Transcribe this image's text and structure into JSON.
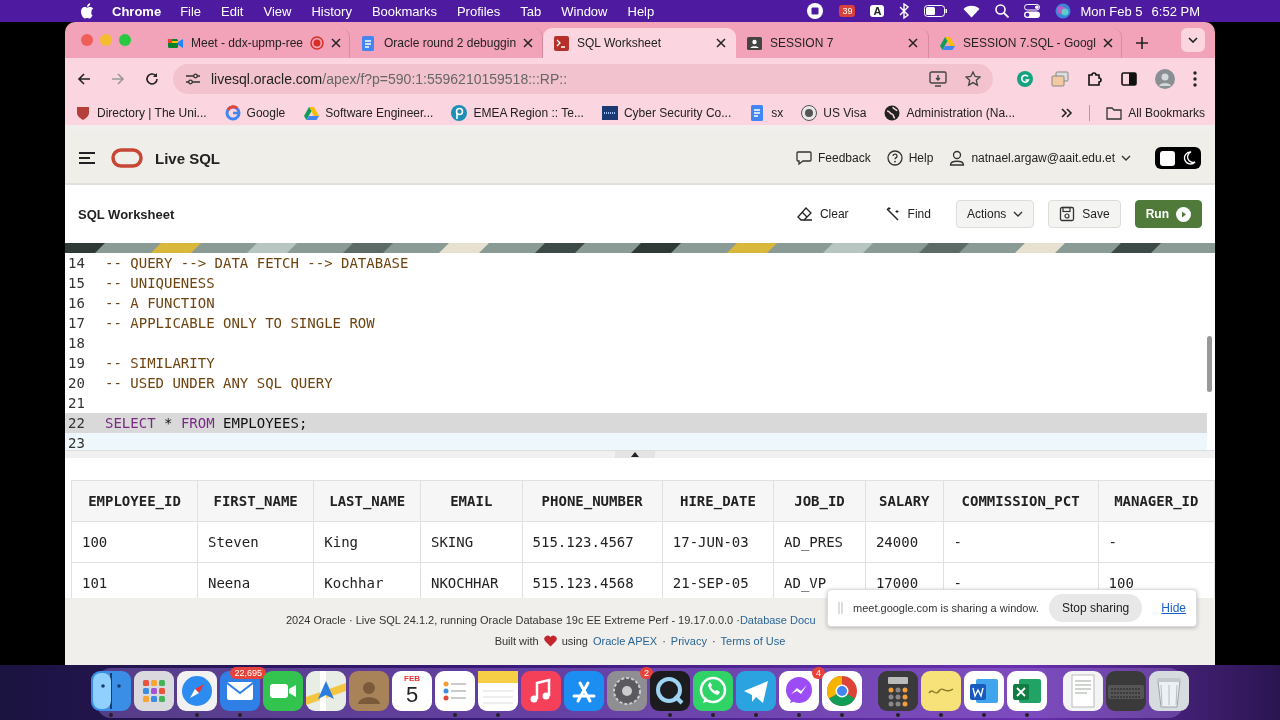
{
  "menubar": {
    "app": "Chrome",
    "menus": [
      "File",
      "Edit",
      "View",
      "History",
      "Bookmarks",
      "Profiles",
      "Tab",
      "Window",
      "Help"
    ],
    "status_badge": "39",
    "input_source": "A",
    "date": "Mon Feb 5",
    "time": "6:52 PM"
  },
  "tabs": [
    {
      "title": "Meet - ddx-upmp-ree",
      "selected": false,
      "recording": true
    },
    {
      "title": "Oracle round 2 debuggin",
      "selected": false,
      "recording": false
    },
    {
      "title": "SQL Worksheet",
      "selected": true,
      "recording": false
    },
    {
      "title": "SESSION 7",
      "selected": false,
      "recording": false
    },
    {
      "title": "SESSION 7.SQL - Googl",
      "selected": false,
      "recording": false
    }
  ],
  "address": {
    "host": "livesql.oracle.com",
    "path": "/apex/f?p=590:1:5596210159518:::RP::"
  },
  "bookmarks": [
    "Directory | The Uni...",
    "Google",
    "Software Engineer...",
    "EMEA Region :: Te...",
    "Cyber Security Co...",
    "sx",
    "US Visa",
    "Administration (Na..."
  ],
  "all_bookmarks": "All Bookmarks",
  "app_header": {
    "brand": "Live SQL",
    "links": [
      "Feedback",
      "Help"
    ],
    "user": "natnael.argaw@aait.edu.et",
    "dark_mode": false
  },
  "worksheet": {
    "title": "SQL Worksheet",
    "buttons": [
      {
        "label": "Clear",
        "kind": "plain"
      },
      {
        "label": "Find",
        "kind": "plain"
      },
      {
        "label": "Actions",
        "kind": "menu"
      },
      {
        "label": "Save",
        "kind": "outlined"
      },
      {
        "label": "Run",
        "kind": "primary"
      }
    ]
  },
  "editor": {
    "lines": [
      {
        "number": "14",
        "selected": false,
        "current": false,
        "tokens": [
          {
            "kind": "comment",
            "text": "-- QUERY --> DATA FETCH --> DATABASE"
          }
        ]
      },
      {
        "number": "15",
        "selected": false,
        "current": false,
        "tokens": [
          {
            "kind": "comment",
            "text": "-- UNIQUENESS"
          }
        ]
      },
      {
        "number": "16",
        "selected": false,
        "current": false,
        "tokens": [
          {
            "kind": "comment",
            "text": "-- A FUNCTION"
          }
        ]
      },
      {
        "number": "17",
        "selected": false,
        "current": false,
        "tokens": [
          {
            "kind": "comment",
            "text": "-- APPLICABLE ONLY TO SINGLE ROW"
          }
        ]
      },
      {
        "number": "18",
        "selected": false,
        "current": false
      },
      {
        "number": "19",
        "selected": false,
        "current": false,
        "tokens": [
          {
            "kind": "comment",
            "text": "-- SIMILARITY"
          }
        ]
      },
      {
        "number": "20",
        "selected": false,
        "current": false,
        "tokens": [
          {
            "kind": "comment",
            "text": "-- USED UNDER ANY SQL QUERY"
          }
        ]
      },
      {
        "number": "21",
        "selected": false,
        "current": false
      },
      {
        "number": "22",
        "selected": true,
        "current": false,
        "tokens": [
          {
            "kind": "keyword",
            "text": "SELECT"
          },
          {
            "kind": "plain",
            "text": "*"
          },
          {
            "kind": "keyword",
            "text": "FROM"
          },
          {
            "kind": "plain",
            "text": "EMPLOYEES;"
          }
        ]
      },
      {
        "number": "23",
        "selected": false,
        "current": true
      }
    ]
  },
  "results": {
    "columns": [
      "EMPLOYEE_ID",
      "FIRST_NAME",
      "LAST_NAME",
      "EMAIL",
      "PHONE_NUMBER",
      "HIRE_DATE",
      "JOB_ID",
      "SALARY",
      "COMMISSION_PCT",
      "MANAGER_ID"
    ],
    "rows": [
      [
        "100",
        "Steven",
        "King",
        "SKING",
        "515.123.4567",
        "17-JUN-03",
        "AD_PRES",
        "24000",
        "-",
        "-"
      ],
      [
        "101",
        "Neena",
        "Kochhar",
        "NKOCHHAR",
        "515.123.4568",
        "21-SEP-05",
        "AD_VP",
        "17000",
        "-",
        "100"
      ]
    ]
  },
  "footer": {
    "line1": "2024 Oracle · Live SQL 24.1.2, running Oracle Database 19c EE Extreme Perf - 19.17.0.0.0 ·",
    "docs_link": "Database Docu",
    "built_with": "Built with",
    "using": "using",
    "items": [
      {
        "kind": "link",
        "text": "Oracle APEX"
      },
      {
        "kind": "sep",
        "text": "·"
      },
      {
        "kind": "link",
        "text": "Privacy"
      },
      {
        "kind": "sep",
        "text": "·"
      },
      {
        "kind": "link",
        "text": "Terms of Use"
      }
    ]
  },
  "sharing": {
    "message": "meet.google.com is sharing a window.",
    "stop": "Stop sharing",
    "hide": "Hide"
  },
  "dock": {
    "sections": [
      [
        {
          "running": true
        },
        {
          "running": false
        },
        {
          "running": true
        },
        {
          "running": true,
          "badge": "22,695"
        },
        {
          "running": false
        },
        {
          "running": false
        },
        {
          "running": false
        },
        {
          "running": false,
          "month": "FEB",
          "day": "5"
        },
        {
          "running": true
        },
        {
          "running": true
        },
        {
          "running": false
        },
        {
          "running": false
        },
        {
          "running": false,
          "badge": "2"
        },
        {
          "running": true
        },
        {
          "running": true
        },
        {
          "running": true
        },
        {
          "running": true,
          "badge": "4"
        },
        {
          "running": true
        }
      ],
      [
        {
          "running": true
        },
        {
          "running": true
        },
        {
          "running": true
        },
        {
          "running": true
        }
      ],
      [
        {
          "running": false
        },
        {
          "running": false
        },
        {
          "running": false
        }
      ]
    ]
  }
}
